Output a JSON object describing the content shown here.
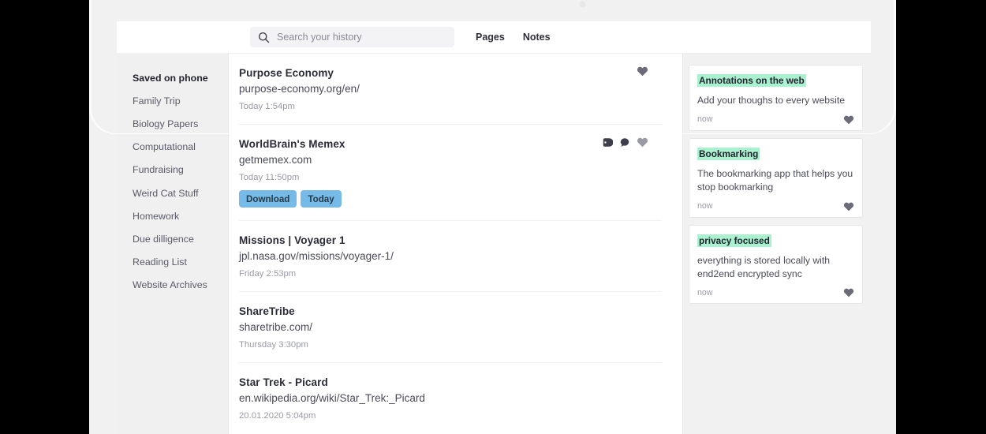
{
  "device": {
    "camera_dot": "camera-dot"
  },
  "header": {
    "search": {
      "placeholder": "Search your history",
      "value": "",
      "icon": "search-icon"
    },
    "tabs": [
      {
        "label": "Pages",
        "active": true
      },
      {
        "label": "Notes",
        "active": false
      }
    ]
  },
  "sidebar": {
    "items": [
      {
        "label": "Saved on phone",
        "active": true
      },
      {
        "label": "Family Trip",
        "active": false
      },
      {
        "label": "Biology Papers",
        "active": false
      },
      {
        "label": "Computational",
        "active": false
      },
      {
        "label": "Fundraising",
        "active": false
      },
      {
        "label": "Weird Cat Stuff",
        "active": false
      },
      {
        "label": "Homework",
        "active": false
      },
      {
        "label": "Due dilligence",
        "active": false
      },
      {
        "label": "Reading List",
        "active": false
      },
      {
        "label": "Website Archives",
        "active": false
      }
    ]
  },
  "history": {
    "entries": [
      {
        "title": "Purpose Economy",
        "url": "purpose-economy.org/en/",
        "time": "Today 1:54pm",
        "icons": [
          "heart-icon"
        ],
        "heart_color": "#6b6b79",
        "tags": []
      },
      {
        "title": "WorldBrain's Memex",
        "url": "getmemex.com",
        "time": "Today 11:50pm",
        "icons": [
          "tag-icon",
          "comment-icon",
          "heart-icon"
        ],
        "heart_color": "#9a9aa6",
        "tags": [
          "Download",
          "Today"
        ]
      },
      {
        "title": "Missions | Voyager 1",
        "url": "jpl.nasa.gov/missions/voyager-1/",
        "time": "Friday 2:53pm",
        "icons": [],
        "tags": []
      },
      {
        "title": "ShareTribe",
        "url": "sharetribe.com/",
        "time": "Thursday 3:30pm",
        "icons": [],
        "tags": []
      },
      {
        "title": "Star Trek - Picard",
        "url": "en.wikipedia.org/wiki/Star_Trek:_Picard",
        "time": "20.01.2020 5:04pm",
        "icons": [],
        "tags": []
      }
    ]
  },
  "annotations": {
    "cards": [
      {
        "highlight": "Annotations on the web",
        "comment": "Add your thoughs to every website",
        "time": "now",
        "icon": "heart-icon"
      },
      {
        "highlight": "Bookmarking",
        "comment": "The bookmarking app that helps you stop bookmarking",
        "time": "now",
        "icon": "heart-icon"
      },
      {
        "highlight": "privacy focused",
        "comment": "everything is stored locally with end2end encrypted sync",
        "time": "now",
        "icon": "heart-icon"
      }
    ]
  },
  "colors": {
    "highlight_green": "#aaf1cf",
    "tag_blue": "#76bae8",
    "heart_dark": "#6b6b79",
    "heart_light": "#9a9aa6",
    "sidebar_bg": "#f0f0f1",
    "panel_bg": "#f1f1f2"
  }
}
